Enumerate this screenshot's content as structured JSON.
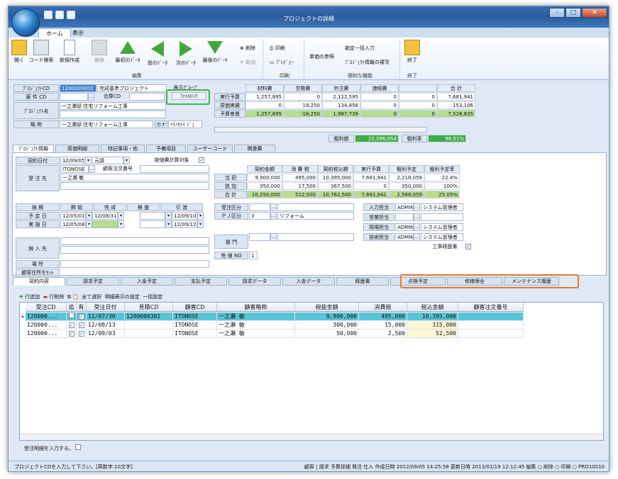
{
  "window": {
    "title": "プロジェクトの詳細"
  },
  "ribbon": {
    "tabs": [
      "ホーム",
      "表示"
    ],
    "open": "開く",
    "code_search": "コード検索",
    "new": "新規作成",
    "save": "保存",
    "first": "最初のﾃﾞｰﾀ",
    "prev": "前のﾃﾞｰﾀ",
    "next": "次のﾃﾞｰﾀ",
    "last": "最後のﾃﾞｰﾀ",
    "delete": "削除",
    "cancel": "取消",
    "print": "印刷",
    "preview": "ﾌﾟﾚﾋﾞｭｰ",
    "unit_ref": "単価の参照",
    "bulk_input": "勘定一括入力",
    "copy_info": "ﾌﾟﾛｼﾞｪｸﾄ情報の複写",
    "exit": "終了",
    "groups": [
      "編集",
      "印刷",
      "便利な機能",
      "終了"
    ]
  },
  "header": {
    "project_cd_label": "ﾌﾟﾛｼﾞｪｸﾄCD",
    "project_cd": "1200000002",
    "project_title": "完成基準プロジェクト",
    "display_label": "表示ｸﾞﾙｰﾌﾟ",
    "case_cd_label": "案 件 CD",
    "ellipsis": "…",
    "combined_cd": "合算CD",
    "file_link": "ﾌｧｲﾙﾘﾝｸ",
    "project_name_label": "ﾌﾟﾛｼﾞｪｸﾄ名",
    "project_name": "一之瀬邸 住宅リフォーム工事",
    "short_label": "略   称",
    "short_name": "一之瀬邸 住宅リフォーム工事",
    "kana": "カナ",
    "kana_value": "ｲﾁﾉｾﾃｲ ｼﾞｭ"
  },
  "cost_grid": {
    "cols": [
      "材料費",
      "労務費",
      "外注費",
      "諸経費",
      "",
      "合  計"
    ],
    "rows": [
      {
        "label": "実行予算",
        "values": [
          "1,257,895",
          "0",
          "2,122,595",
          "0",
          "0",
          "7,681,941"
        ]
      },
      {
        "label": "原価実績",
        "values": [
          "0",
          "18,250",
          "134,856",
          "0",
          "0",
          "153,106"
        ]
      },
      {
        "label": "予算差異",
        "values": [
          "1,257,895",
          "-18,250",
          "1,987,739",
          "0",
          "0",
          "7,528,835"
        ]
      }
    ],
    "profit_label": "粗利額",
    "profit": "10,096,054",
    "rate_label": "粗利率",
    "rate": "98.51%"
  },
  "section_tabs": [
    "ﾌﾟﾛｼﾞｪｸﾄ情報",
    "原価明細",
    "特記事項・他",
    "予備項目",
    "ユーザーコード",
    "関連費"
  ],
  "info": {
    "contract_date_label": "契約日付",
    "contract_date": "12/09/05",
    "moto": "元請",
    "pct_label": "按値費計算対象",
    "pct_check": "✓",
    "customer_label": "受 注 先",
    "customer_code": "ITONOSE",
    "customer_order_label": "顧客注文番号",
    "customer_name": "一之瀬 敏",
    "amt_cols": [
      "契約金額",
      "消 費 税",
      "契約税込額",
      "実行予算",
      "粗利予定",
      "粗利予定率"
    ],
    "amt_rows": [
      {
        "label": "当   初",
        "values": [
          "9,900,000",
          "495,000",
          "10,395,000",
          "7,681,941",
          "2,218,059",
          "22.4%"
        ]
      },
      {
        "label": "追   加",
        "values": [
          "350,000",
          "17,500",
          "367,500",
          "0",
          "350,000",
          "100%"
        ]
      },
      {
        "label": "合   計",
        "values": [
          "10,250,000",
          "512,500",
          "10,762,500",
          "7,681,941",
          "2,568,059",
          "25.05%"
        ]
      }
    ],
    "sched_cols": [
      "納   期",
      "開   始",
      "完   成",
      "検   査",
      "引   渡"
    ],
    "plan_label": "予 定 日",
    "plan": [
      "12/05/01",
      "12/08/31",
      "",
      "12/09/10"
    ],
    "actual_label": "実 施 日",
    "actual": [
      "12/05/08",
      "",
      "",
      "12/09/12"
    ],
    "order_kbn_label": "受注区分",
    "pj_kbn_label": "ＰＪ区分",
    "pj_kbn_code": "3",
    "pj_kbn": "リフォーム",
    "input_tanto_label": "入力担当",
    "eigyo_label": "営業担当",
    "genba_label": "現場担当",
    "gijutsu_label": "技術担当",
    "admin": "ADMIN",
    "sys_admin": "システム管理者",
    "dept_label": "部   門",
    "kouji_label": "工事経歴書",
    "delivery_label": "納 入 先",
    "place_label": "場   所",
    "addr_label": "顧客住所をｾｯﾄ",
    "seq_label": "売 値 NO",
    "seq": "1"
  },
  "detail_tabs": [
    "契約内容",
    "請求予定",
    "入金予定",
    "支払予定",
    "請求データ",
    "入金データ",
    "経歴書",
    "点検予定",
    "修繕保全",
    "メンテナンス履歴"
  ],
  "list_toolbar": [
    "行追加",
    "行削除",
    "全て選択",
    "明細表示の設定",
    "一括設定"
  ],
  "list": {
    "headers": [
      "受注CD",
      "追",
      "有",
      "受注日付",
      "見積CD",
      "顧客CD",
      "顧客略称",
      "税抜金額",
      "消費税",
      "税込金額",
      "顧客注文番号"
    ],
    "rows": [
      {
        "cd": "120000...",
        "add": "",
        "has": "✓",
        "date": "12/07/30",
        "est": "1200000301",
        "cust": "ITONOSE",
        "name": "一之瀬 敏",
        "net": "9,900,000",
        "tax": "495,000",
        "gross": "10,395,000",
        "po": ""
      },
      {
        "cd": "120000...",
        "add": "✓",
        "has": "✓",
        "date": "12/08/13",
        "est": "",
        "cust": "ITONOSE",
        "name": "一之瀬 敏",
        "net": "300,000",
        "tax": "15,000",
        "gross": "315,000",
        "po": ""
      },
      {
        "cd": "120000...",
        "add": "✓",
        "has": "✓",
        "date": "12/09/03",
        "est": "",
        "cust": "ITONOSE",
        "name": "一之瀬 敏",
        "net": "50,000",
        "tax": "2,500",
        "gross": "52,500",
        "po": ""
      }
    ]
  },
  "footer_note": "受注明細を入力する。",
  "status": {
    "left": "プロジェクトCDを入力して下さい。[英数字:10文字]",
    "right": "顧客 | 請求  予算詳細  発注  仕入  作成日時 2012/09/05 14:25:58  更新日時 2013/01/19 12:12:45  編集  ○  削除  ○  印刷  ○  PRO10010"
  },
  "colors": {
    "green_highlight": "#39b54a",
    "orange_highlight": "#e07b2a",
    "selected_row": "#59c4d6",
    "profit_fill": "#3fae46"
  }
}
